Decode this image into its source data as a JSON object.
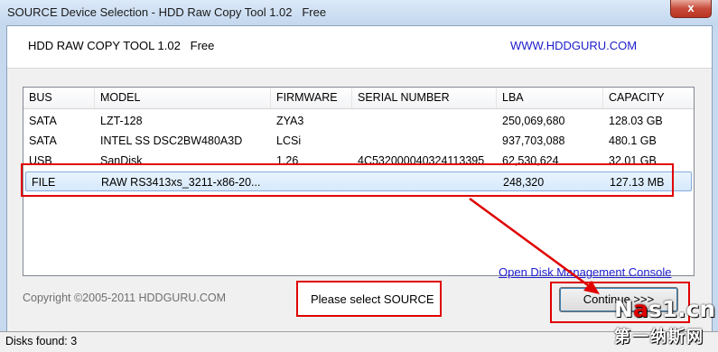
{
  "window": {
    "title": "SOURCE Device Selection - HDD Raw Copy Tool 1.02   Free",
    "close_glyph": "x"
  },
  "header": {
    "app_name": "HDD RAW COPY TOOL 1.02   Free",
    "site": "WWW.HDDGURU.COM"
  },
  "device_list": {
    "columns": [
      "BUS",
      "MODEL",
      "FIRMWARE",
      "SERIAL NUMBER",
      "LBA",
      "CAPACITY"
    ],
    "rows": [
      {
        "bus": "SATA",
        "model": "LZT-128",
        "firmware": "ZYA3",
        "serial": "",
        "lba": "250,069,680",
        "capacity": "128.03 GB"
      },
      {
        "bus": "SATA",
        "model": "INTEL SS DSC2BW480A3D",
        "firmware": "LCSi",
        "serial": "",
        "lba": "937,703,088",
        "capacity": "480.1 GB"
      },
      {
        "bus": "USB",
        "model": "SanDisk",
        "firmware": "1.26",
        "serial": "4C532000040324113395",
        "lba": "62,530,624",
        "capacity": "32.01 GB"
      },
      {
        "bus": "FILE",
        "model": "RAW RS3413xs_3211-x86-20...",
        "firmware": "",
        "serial": "",
        "lba": "248,320",
        "capacity": "127.13 MB"
      }
    ],
    "selected_index": 3
  },
  "links": {
    "disk_management": "Open Disk Management Console"
  },
  "footer": {
    "copyright": "Copyright ©2005-2011 HDDGURU.COM",
    "status": "Please select SOURCE",
    "continue_label": "Continue >>>"
  },
  "statusbar": {
    "text": "Disks found: 3"
  },
  "watermark": {
    "line1_prefix": "N",
    "line1_accent": "a",
    "line1_rest": "s1.cn",
    "line2": "第一纳斯网"
  },
  "colors": {
    "highlight_red": "#e00000",
    "link_blue": "#1c1ccc",
    "selection_blue": "#84acdd"
  }
}
